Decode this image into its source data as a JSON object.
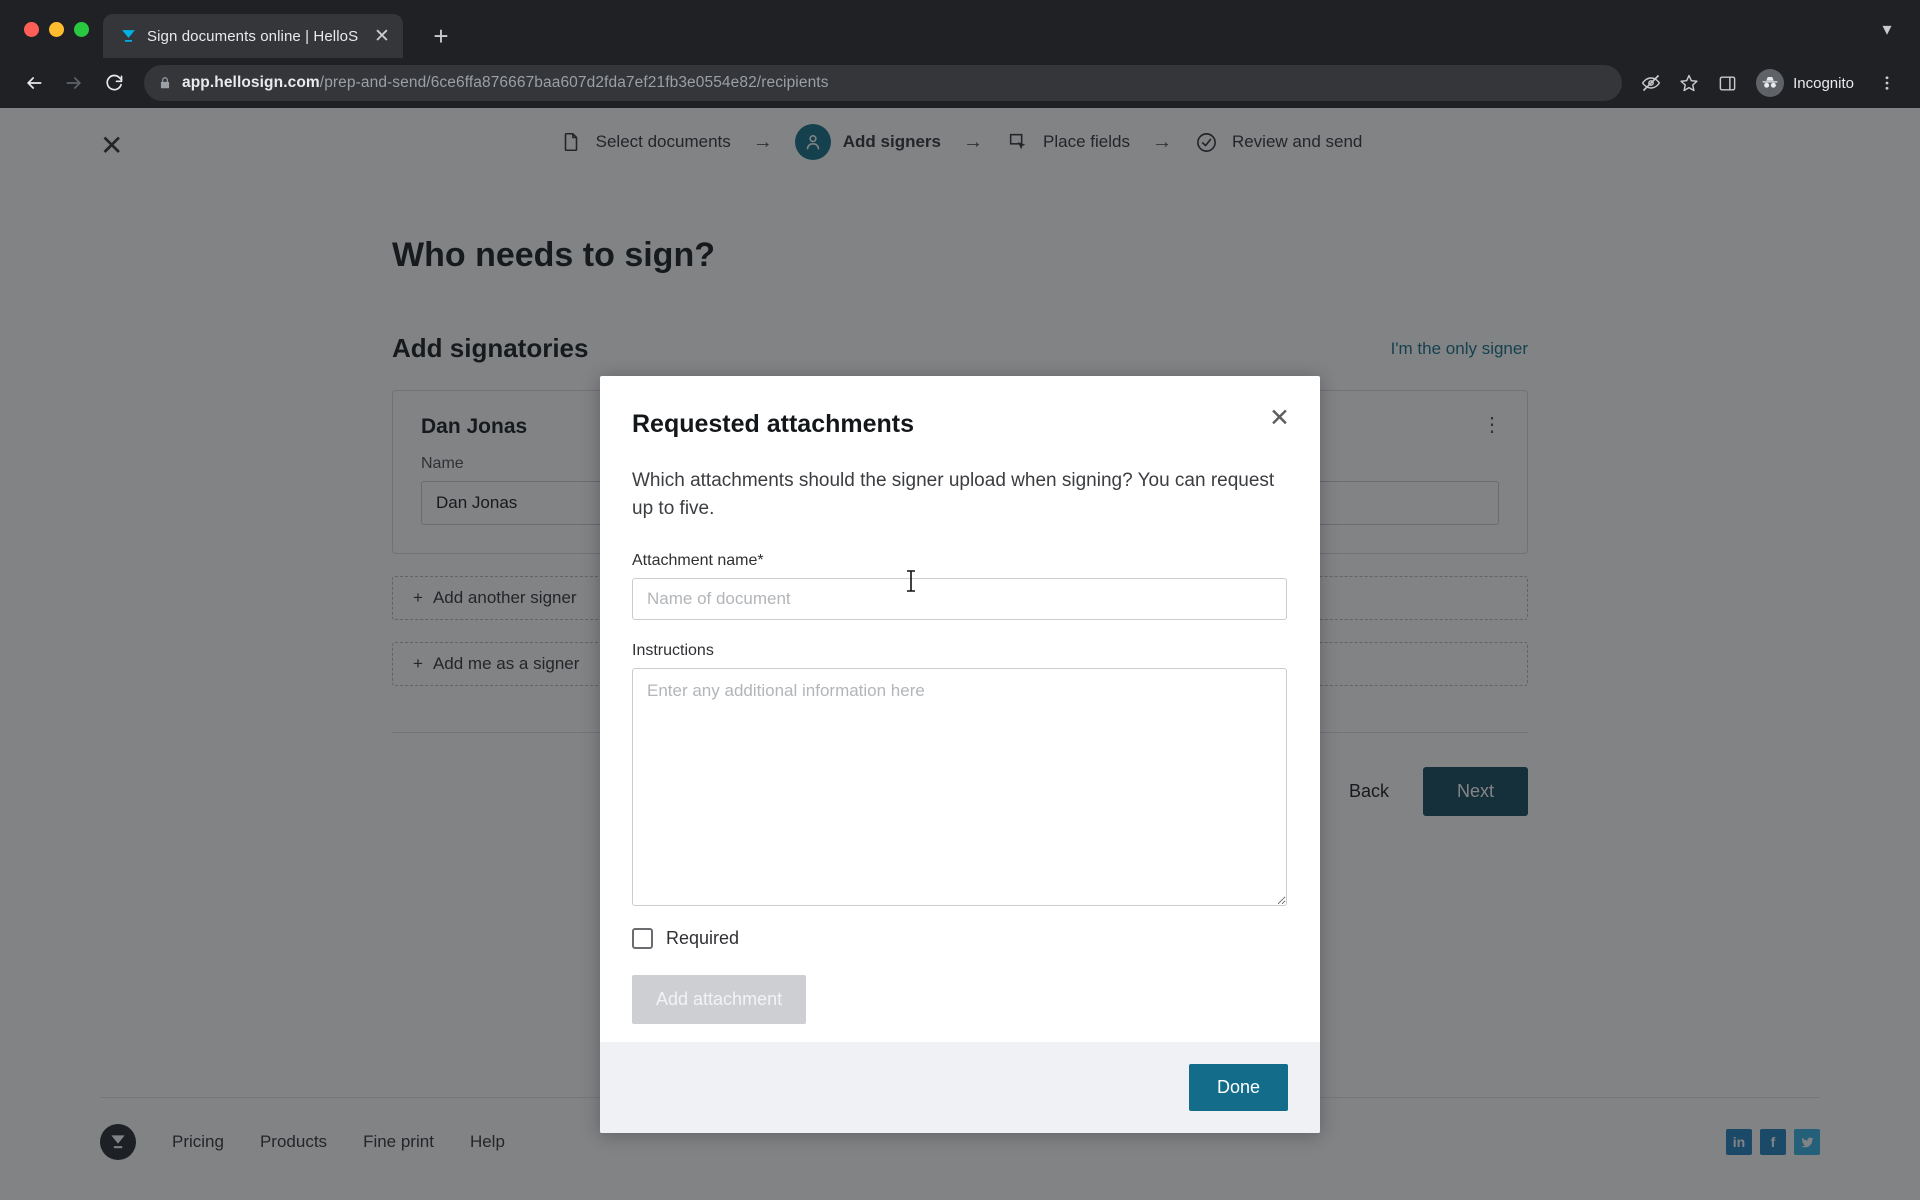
{
  "browser": {
    "tab": {
      "title": "Sign documents online | HelloS",
      "favicon_icon": "hellosign-logo-icon",
      "close_icon": "close-icon"
    },
    "new_tab_icon": "plus-icon",
    "tabstrip_chevron_icon": "chevron-down-icon",
    "nav": {
      "back_icon": "arrow-left-icon",
      "forward_icon": "arrow-right-icon",
      "reload_icon": "reload-icon"
    },
    "url": {
      "lock_icon": "lock-icon",
      "host": "app.hellosign.com",
      "path": "/prep-and-send/6ce6ffa876667baa607d2fda7ef21fb3e0554e82/recipients"
    },
    "toolbar_icons": {
      "cookie_blocked_icon": "eye-slash-icon",
      "bookmark_icon": "star-icon",
      "side_panel_icon": "side-panel-icon",
      "menu_icon": "three-dot-menu-icon"
    },
    "profile": {
      "label": "Incognito",
      "avatar_icon": "incognito-avatar-icon"
    }
  },
  "app": {
    "close_icon": "close-icon",
    "stepper": [
      {
        "label": "Select documents",
        "icon": "document-icon",
        "active": false
      },
      {
        "label": "Add signers",
        "icon": "person-icon",
        "active": true
      },
      {
        "label": "Place fields",
        "icon": "place-fields-icon",
        "active": false
      },
      {
        "label": "Review and send",
        "icon": "check-circle-icon",
        "active": false
      }
    ],
    "arrow_icon": "arrow-right-icon",
    "page_title": "Who needs to sign?",
    "section_title": "Add signatories",
    "only_signer_link": "I'm the only signer",
    "signer": {
      "name_heading": "Dan Jonas",
      "name_field_label": "Name",
      "name_field_value": "Dan Jonas",
      "email_field_value": "",
      "kebab_icon": "kebab-menu-icon"
    },
    "add_another_signer": "Add another signer",
    "add_me_as_signer": "Add me as a signer",
    "plus_icon": "plus-icon",
    "back_button": "Back",
    "next_button": "Next"
  },
  "footer": {
    "logo_icon": "hellosign-logo-icon",
    "links": [
      "Pricing",
      "Products",
      "Fine print",
      "Help"
    ],
    "socials": [
      {
        "name": "linkedin-icon",
        "label": "in"
      },
      {
        "name": "facebook-icon",
        "label": "f"
      },
      {
        "name": "twitter-icon",
        "label": "t"
      }
    ]
  },
  "modal": {
    "title": "Requested attachments",
    "close_icon": "close-icon",
    "description": "Which attachments should the signer upload when signing? You can request up to five.",
    "attachment_name_label": "Attachment name*",
    "attachment_name_value": "",
    "attachment_name_placeholder": "Name of document",
    "instructions_label": "Instructions",
    "instructions_value": "",
    "instructions_placeholder": "Enter any additional information here",
    "required_label": "Required",
    "required_checked": false,
    "add_attachment_button": "Add attachment",
    "done_button": "Done"
  },
  "colors": {
    "accent_teal": "#0f6e87",
    "done_button": "#136d8a",
    "next_button": "#11485c",
    "disabled_button": "#cdcfd2",
    "modal_footer_bg": "#f0f1f5"
  }
}
